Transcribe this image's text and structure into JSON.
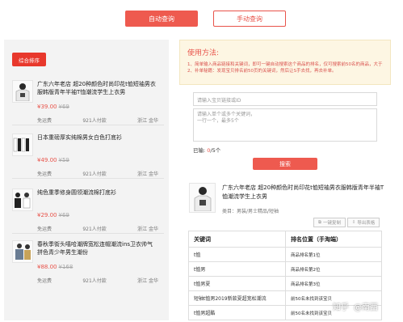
{
  "tabs": {
    "auto": "自动查询",
    "manual": "手动查询"
  },
  "left": {
    "sort_label": "综合排序",
    "products": [
      {
        "title": "广东六年老店 超20种颜色时尚印花t恤短袖男衣服韩版青年半袖T恤潮流学生上衣男",
        "price": "¥39.00",
        "orig_price": "¥69",
        "shipping": "免运费",
        "buyers": "921人付款",
        "location": "浙江 金华"
      },
      {
        "title": "日本重磅厚实纯棉男女白色打底衫",
        "price": "¥49.00",
        "orig_price": "¥59",
        "shipping": "免运费",
        "buyers": "921人付款",
        "location": "浙江 金华"
      },
      {
        "title": "纯色重季修身圆领潮流棉打底衫",
        "price": "¥29.00",
        "orig_price": "¥69",
        "shipping": "免运费",
        "buyers": "921人付款",
        "location": "浙江 金华"
      },
      {
        "title": "春秋季街头嘻哈潮牌宽松连帽潮流ins卫衣帅气拼色青少年男生潮份",
        "price": "¥88.00",
        "orig_price": "¥168",
        "shipping": "免运费",
        "buyers": "921人付款",
        "location": "浙江 金华"
      }
    ]
  },
  "help": {
    "title": "使用方法:",
    "line1": "1、简单输入商品链接和关键词，即可一键自动搜索这个商品的排名，仅可搜索前50名的商品，大于50名无法检索。",
    "line2": "2、补单秘籍：发现宝贝排名前50页的关键词，然后让S手去找，再去补单。"
  },
  "form": {
    "url_placeholder": "请输入宝贝链接或ID",
    "keywords_placeholder": "请输入单个或多个关键词，\n一行一个，最多5个",
    "count_prefix": "已输: ",
    "count_value": "0",
    "count_suffix": "/5个",
    "search_label": "搜索"
  },
  "result": {
    "title": "广东六年老店 超20种颜色时尚印花t恤短袖男衣服韩版青年半袖T恤潮流学生上衣男",
    "category": "类目：男装/男士精品/短袖",
    "copy_label": "一键复制",
    "export_label": "导出表格",
    "headers": [
      "关键词",
      "排名位置（手淘端）"
    ],
    "rows": [
      [
        "t恤",
        "商品排名第1位"
      ],
      [
        "t恤男",
        "商品排名第2位"
      ],
      [
        "t恤男夏",
        "商品排名第3位"
      ],
      [
        "短袖t恤男2019新款夏超宽松潮流",
        "前50名未找到该宝贝"
      ],
      [
        "t恤男超酷"
      ]
    ],
    "row5_pos": "前50名未找到该宝贝"
  },
  "watermark": {
    "brand": "知乎",
    "user": "@南西"
  },
  "colors": {
    "accent": "#ee5a4f",
    "help_bg": "#fdf6e3"
  }
}
